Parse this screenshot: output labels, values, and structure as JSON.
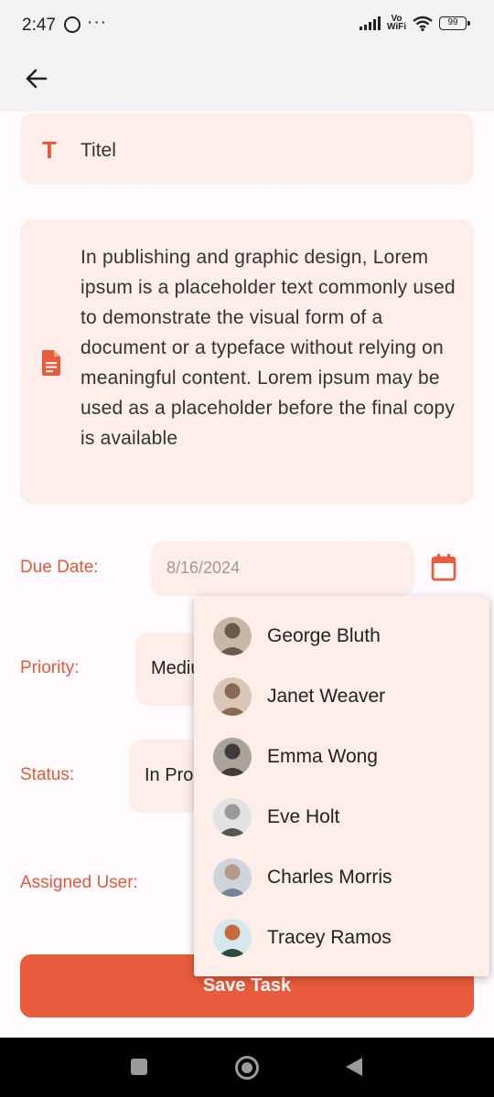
{
  "status_bar": {
    "time": "2:47",
    "more": "···",
    "network": "Vo\nWiFi",
    "battery": "99"
  },
  "app_bar": {
    "back_icon": "arrow-back-icon"
  },
  "form": {
    "title": {
      "icon": "T",
      "value": "Titel"
    },
    "description": {
      "icon": "document-icon",
      "value": "In publishing and graphic design, Lorem ipsum is a placeholder text commonly used to demonstrate the visual form of a document or a typeface without relying on meaningful content. Lorem ipsum may be used as a placeholder before the final copy is available"
    },
    "due_date": {
      "label": "Due Date:",
      "value": "8/16/2024",
      "icon": "calendar-icon"
    },
    "priority": {
      "label": "Priority:",
      "value": "Medium"
    },
    "status": {
      "label": "Status:",
      "value": "In Progress"
    },
    "assigned_user": {
      "label": "Assigned User:"
    },
    "save_label": "Save Task"
  },
  "user_dropdown": {
    "options": [
      {
        "name": "George Bluth",
        "avatar_color": "#6b5a4a"
      },
      {
        "name": "Janet Weaver",
        "avatar_color": "#8a6a55"
      },
      {
        "name": "Emma Wong",
        "avatar_color": "#3e3b3a"
      },
      {
        "name": "Eve Holt",
        "avatar_color": "#9a9a9a"
      },
      {
        "name": "Charles Morris",
        "avatar_color": "#b39a86"
      },
      {
        "name": "Tracey Ramos",
        "avatar_color": "#c86a40"
      }
    ]
  },
  "colors": {
    "accent": "#e85c3d",
    "surface": "#fdeee9",
    "label": "#e05a3d"
  }
}
